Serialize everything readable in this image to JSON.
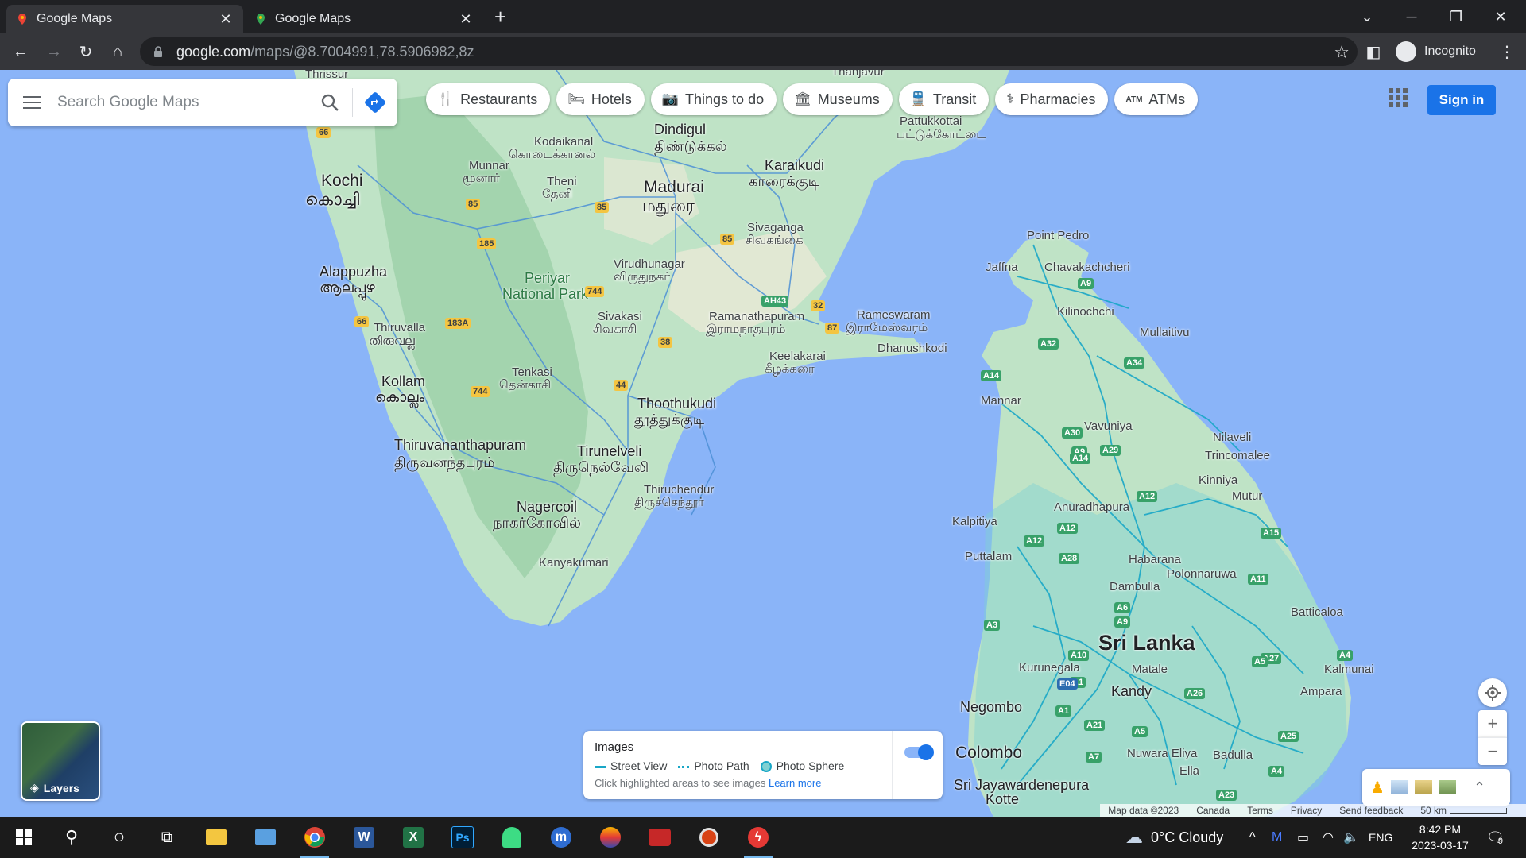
{
  "browser": {
    "tabs": [
      {
        "title": "Google Maps",
        "active": true
      },
      {
        "title": "Google Maps",
        "active": false
      }
    ],
    "url_host": "google.com",
    "url_path": "/maps/@8.7004991,78.5906982,8z",
    "profile": "Incognito"
  },
  "maps": {
    "search_placeholder": "Search Google Maps",
    "chips": [
      {
        "icon": "restaurant-icon",
        "label": "Restaurants"
      },
      {
        "icon": "hotel-icon",
        "label": "Hotels"
      },
      {
        "icon": "camera-icon",
        "label": "Things to do"
      },
      {
        "icon": "museum-icon",
        "label": "Museums"
      },
      {
        "icon": "transit-icon",
        "label": "Transit"
      },
      {
        "icon": "pharmacy-icon",
        "label": "Pharmacies"
      },
      {
        "icon": "atm-icon",
        "label": "ATMs"
      }
    ],
    "signin": "Sign in",
    "layers_label": "Layers",
    "images_panel": {
      "title": "Images",
      "legend": [
        "Street View",
        "Photo Path",
        "Photo Sphere"
      ],
      "hint": "Click highlighted areas to see images",
      "learn_more": "Learn more",
      "toggle_on": true
    },
    "footer": [
      "Map data ©2023",
      "Canada",
      "Terms",
      "Privacy",
      "Send feedback",
      "50 km"
    ],
    "colors": {
      "water": "#8ab4f8",
      "land": "#bfe3c6",
      "street_view": "#19a7c7",
      "accent": "#1a73e8"
    },
    "places": {
      "thrissur": "Thrissur",
      "thanjavur": "Thanjavur",
      "dindigul": "Dindigul",
      "dindigul_ta": "திண்டுக்கல்",
      "kodaikanal": "Kodaikanal",
      "kodaikanal_ta": "கொடைக்கானல்",
      "pattukkottai": "Pattukkottai",
      "pattukkottai_ta": "பட்டுக்கோட்டை",
      "kochi": "Kochi",
      "kochi_ml": "കൊച്ചി",
      "munnar": "Munnar",
      "munnar_ta": "மூனார்",
      "theni": "Theni",
      "theni_ta": "தேனி",
      "madurai": "Madurai",
      "madurai_ta": "மதுரை",
      "karaikudi": "Karaikudi",
      "karaikudi_ta": "காரைக்குடி",
      "sivaganga": "Sivaganga",
      "sivaganga_ta": "சிவகங்கை",
      "alappuzha": "Alappuzha",
      "alappuzha_ml": "ആലപ്പുഴ",
      "periyar": "Periyar",
      "periyar2": "National Park",
      "virudhunagar": "Virudhunagar",
      "virudhunagar_ta": "விருதுநகர்",
      "thiruvalla": "Thiruvalla",
      "thiruvalla_ml": "തിരുവല്ല",
      "sivakasi": "Sivakasi",
      "sivakasi_ta": "சிவகாசி",
      "ramanathapuram": "Ramanathapuram",
      "ramanathapuram_ta": "இராமநாதபுரம்",
      "rameswaram": "Rameswaram",
      "rameswaram_ta": "இராமேஸ்வரம்",
      "dhanushkodi": "Dhanushkodi",
      "keelakarai": "Keelakarai",
      "keelakarai_ta": "கீழக்கரை",
      "kollam": "Kollam",
      "kollam_ml": "കൊല്ലം",
      "tenkasi": "Tenkasi",
      "tenkasi_ta": "தென்காசி",
      "thoothukudi": "Thoothukudi",
      "thoothukudi_ta": "தூத்துக்குடி",
      "thiruvananthapuram": "Thiruvananthapuram",
      "thiruvananthapuram_ta": "திருவனந்தபுரம்",
      "tirunelveli": "Tirunelveli",
      "tirunelveli_ta": "திருநெல்வேலி",
      "thiruchendur": "Thiruchendur",
      "thiruchendur_ta": "திருச்செந்தூர்",
      "nagercoil": "Nagercoil",
      "nagercoil_ta": "நாகர்கோவில்",
      "kanyakumari": "Kanyakumari",
      "point_pedro": "Point Pedro",
      "jaffna": "Jaffna",
      "chavakachcheri": "Chavakachcheri",
      "kilinochchi": "Kilinochchi",
      "mullaitivu": "Mullaitivu",
      "mannar": "Mannar",
      "vavuniya": "Vavuniya",
      "nilaveli": "Nilaveli",
      "trincomalee": "Trincomalee",
      "kinniya": "Kinniya",
      "mutur": "Mutur",
      "anuradhapura": "Anuradhapura",
      "kalpitiya": "Kalpitiya",
      "puttalam": "Puttalam",
      "habarana": "Habarana",
      "polonnaruwa": "Polonnaruwa",
      "dambulla": "Dambulla",
      "batticaloa": "Batticaloa",
      "sri_lanka": "Sri Lanka",
      "kurunegala": "Kurunegala",
      "matale": "Matale",
      "kalmunai": "Kalmunai",
      "ampara": "Ampara",
      "kandy": "Kandy",
      "negombo": "Negombo",
      "nuwara_eliya": "Nuwara Eliya",
      "badulla": "Badulla",
      "colombo": "Colombo",
      "ella": "Ella",
      "sjk": "Sri Jayawardenepura",
      "kotte": "Kotte"
    },
    "shields": [
      "66",
      "85",
      "85",
      "185",
      "85",
      "744",
      "32",
      "AH43",
      "66",
      "183A",
      "87",
      "38",
      "744",
      "44",
      "A9",
      "A32",
      "A34",
      "A14",
      "A30",
      "A9",
      "A29",
      "A14",
      "A12",
      "A12",
      "A12",
      "A28",
      "A15",
      "A11",
      "A6",
      "A9",
      "A3",
      "A10",
      "A27",
      "A4",
      "A5",
      "A1",
      "E04",
      "A26",
      "A21",
      "A5",
      "A7",
      "A1",
      "A25",
      "A4",
      "A23"
    ]
  },
  "taskbar": {
    "weather": "0°C  Cloudy",
    "lang": "ENG",
    "time": "8:42 PM",
    "date": "2023-03-17",
    "notifications": "9"
  }
}
